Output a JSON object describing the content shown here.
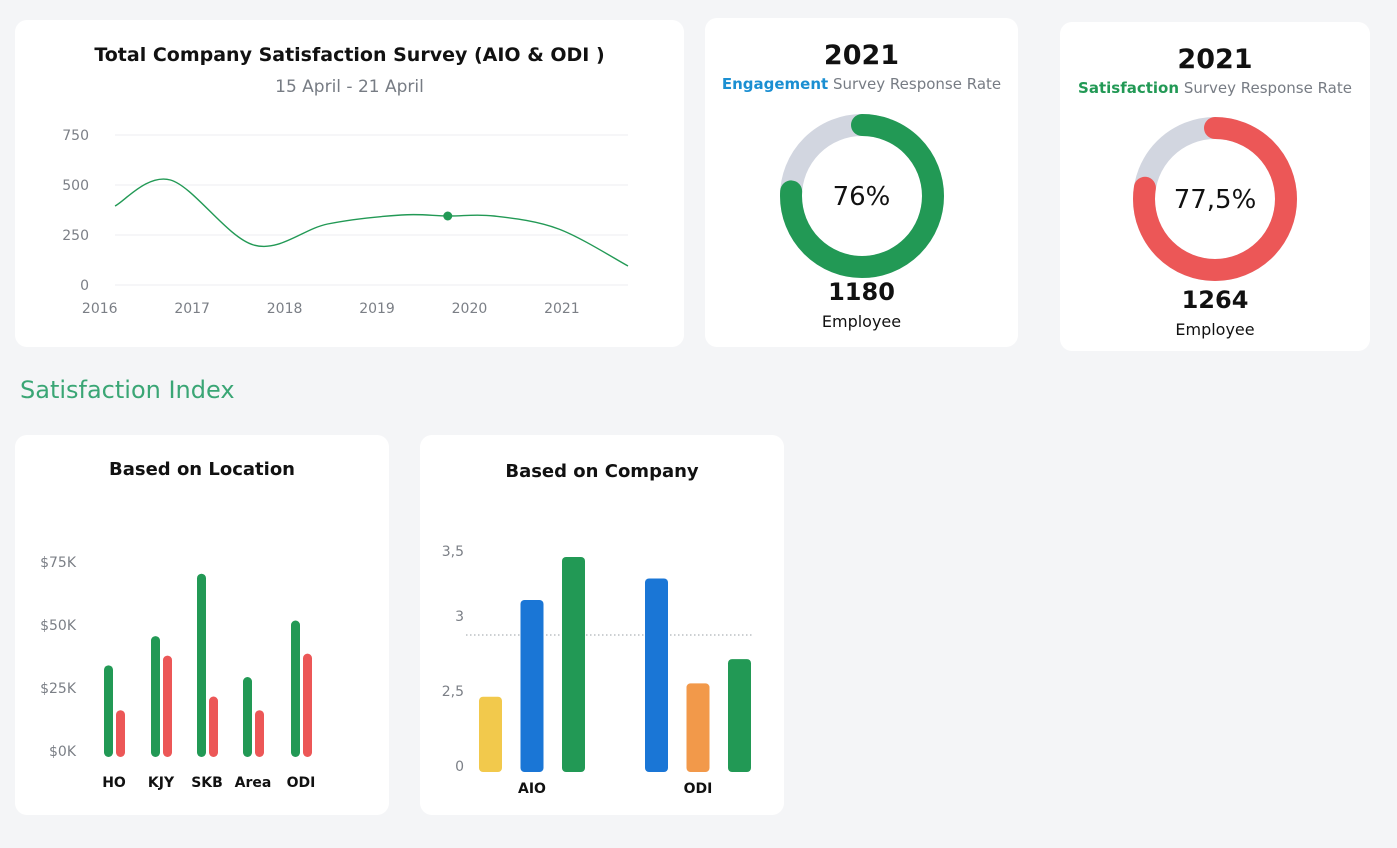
{
  "colors": {
    "green": "#229955",
    "red": "#ec5757",
    "blue": "#1a76d6",
    "yellow": "#f2c94c",
    "orange": "#f2994a",
    "ring_track": "#d2d6e0",
    "section_title": "#3aa675",
    "engagement_word": "#1b8fd2",
    "satisfaction_word": "#229955"
  },
  "survey": {
    "title": "Total Company Satisfaction Survey (AIO & ODI )",
    "subtitle": "15 April - 21 April"
  },
  "engagement": {
    "year": "2021",
    "highlight": "Engagement",
    "rest": " Survey Response Rate",
    "percent_text": "76%",
    "percent_value": 76,
    "count": "1180",
    "count_label": "Employee"
  },
  "satisfaction": {
    "year": "2021",
    "highlight": "Satisfaction",
    "rest": " Survey Response Rate",
    "percent_text": "77,5%",
    "percent_value": 77.5,
    "count": "1264",
    "count_label": "Employee"
  },
  "section": {
    "title": "Satisfaction Index"
  },
  "location": {
    "title": "Based on Location"
  },
  "company": {
    "title": "Based on Company"
  },
  "chart_data": [
    {
      "type": "line",
      "x": [
        2015.7,
        2016.3,
        2017.2,
        2018.0,
        2018.8,
        2019.3,
        2019.8,
        2020.5,
        2021.25
      ],
      "y": [
        395,
        525,
        200,
        305,
        350,
        345,
        345,
        280,
        95
      ],
      "x_ticks": [
        "2016",
        "2017",
        "2018",
        "2019",
        "2020",
        "2021"
      ],
      "y_ticks": [
        "750",
        "500",
        "250",
        "0"
      ],
      "ylim": [
        0,
        750
      ],
      "highlight_point": {
        "x": 2019.3,
        "y": 345
      },
      "grid": true
    },
    {
      "type": "bar",
      "categories": [
        "HO",
        "KJY",
        "SKB",
        "Area",
        "ODI"
      ],
      "series": [
        {
          "values": [
            47,
            62,
            94,
            41,
            70
          ]
        },
        {
          "values": [
            24,
            52,
            31,
            24,
            53
          ]
        }
      ],
      "y_ticks": [
        "$75K",
        "$50K",
        "$25K",
        "$0K"
      ],
      "ylim": [
        0,
        100
      ]
    },
    {
      "type": "bar",
      "categories": [
        "AIO",
        "ODI"
      ],
      "series_values": [
        [
          1.4,
          3.2,
          4.0
        ],
        [
          3.6,
          1.65,
          2.1
        ]
      ],
      "bar_colors": [
        [
          "#f2c94c",
          "#1a76d6",
          "#229955"
        ],
        [
          "#1a76d6",
          "#f2994a",
          "#229955"
        ]
      ],
      "y_ticks": [
        "3,5",
        "3",
        "2,5",
        "0"
      ],
      "ylim": [
        0,
        4
      ],
      "reference_line": 2.55
    }
  ]
}
